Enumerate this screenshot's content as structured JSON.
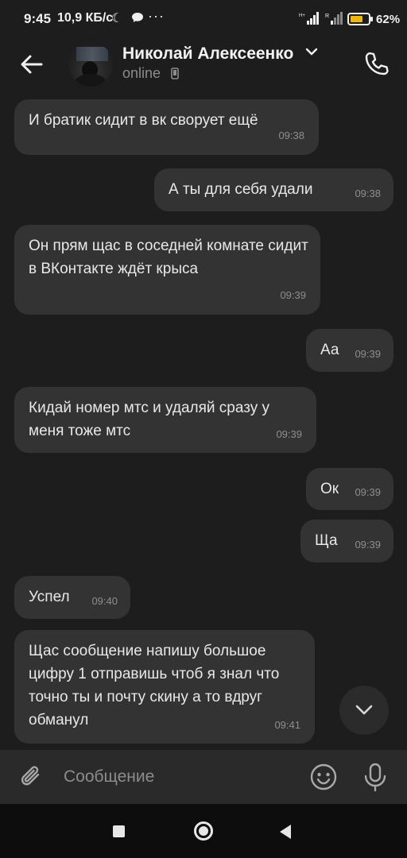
{
  "status_bar": {
    "time": "9:45",
    "speed": "10,9 КБ/с",
    "dots": "···",
    "battery_percent": "62"
  },
  "header": {
    "contact_name": "Николай Алексеенко",
    "status": "online"
  },
  "messages": [
    {
      "side": "in",
      "text": "И братик сидит в вк сворует ещё",
      "time": "09:38"
    },
    {
      "side": "out",
      "text": "А ты для себя удали",
      "time": "09:38"
    },
    {
      "side": "in",
      "text": "Он прям щас в соседней комнате сидит в ВКонтакте ждёт крыса",
      "time": "09:39"
    },
    {
      "side": "out",
      "text": "Аа",
      "time": "09:39"
    },
    {
      "side": "in",
      "text": "Кидай номер мтс и удаляй сразу у меня тоже мтс",
      "time": "09:39"
    },
    {
      "side": "out",
      "text": "Ок",
      "time": "09:39"
    },
    {
      "side": "out",
      "text": "Ща",
      "time": "09:39"
    },
    {
      "side": "in",
      "text": "Успел",
      "time": "09:40"
    },
    {
      "side": "in",
      "text": "Щас сообщение напишу большое цифру 1 отправишь чтоб я знал что точно ты и почту скину а то вдруг обманул",
      "time": "09:41"
    }
  ],
  "composer": {
    "placeholder": "Сообщение"
  },
  "icons": {
    "back": "arrow-left-icon",
    "call": "phone-icon",
    "attach": "paperclip-icon",
    "emoji": "emoji-icon",
    "mic": "microphone-icon",
    "scroll_down": "chevron-down-icon"
  }
}
